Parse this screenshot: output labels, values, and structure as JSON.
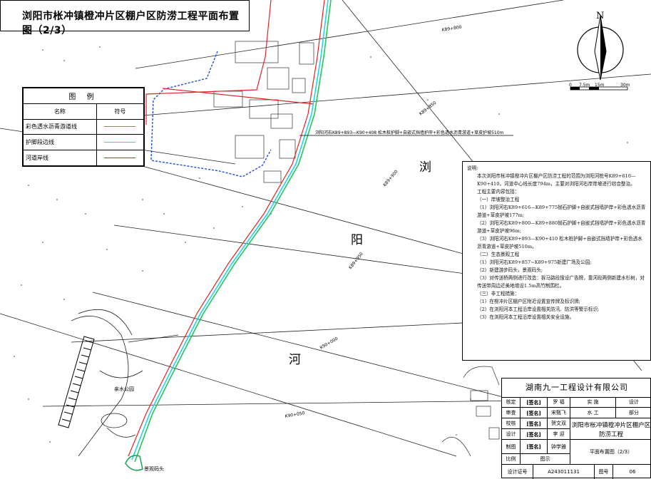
{
  "title": "浏阳市枨冲镇橙冲片区棚户区防涝工程平面布置图（2/3）",
  "legend": {
    "heading": "图 例",
    "col_name": "名称",
    "col_symbol": "符号",
    "items": [
      {
        "name": "彩色透水沥青游道线",
        "color": "#22c55e"
      },
      {
        "name": "护脚段边线",
        "color": "#22d3ee"
      },
      {
        "name": "河道岸线",
        "color": "#dc2626"
      }
    ]
  },
  "north": {
    "letter": "N",
    "scale_ticks": [
      "0",
      "7.5m",
      "15m",
      "30m"
    ]
  },
  "river_chars": [
    "浏",
    "阳",
    "河"
  ],
  "annotations": {
    "callout": "浏阳河右K89+893—K90+408 松木桩护脚+自嵌式挡墙护岸+彩色透水沥青游道+草皮护坡510m",
    "park": "亲水公园",
    "pier": "景观码头"
  },
  "chainage": [
    "K89+800",
    "K89+850",
    "K89+900",
    "K89+950",
    "K90+000",
    "K90+050"
  ],
  "notes": {
    "heading": "说明:",
    "lines": [
      "本次浏阳市枨冲镇橙冲片区棚户区防涝工程的范围为浏阳河桩号K89+616—K90+410，河道中心线长度794m，主要对浏阳河右岸岸坡进行综合整治。",
      "工程主要内容包括：",
      "（一）岸坡整治工程",
      "（1）浏阳河右K89+616—K89+775抛石护脚+自嵌式挡墙护岸+彩色透水沥青游道+草皮护坡177m;",
      "（2）浏阳河右K89+800—K89+880抛石护脚+自嵌式挡墙护岸+彩色透水沥青游道+草皮护坡96m;",
      "（3）浏阳河右K89+893—K90+410 松木桩护脚+自嵌式挡墙护岸+彩色透水沥青游道+草皮护坡510m。",
      "（二）生态景观工程",
      "（1）浏阳河右K89+857~K89+975新建广场及公园;",
      "（2）新建游步码头，景观码头;",
      "（3）对传送桥两侧进行改造：拆马路段搜设广告牌，靠河段两侧新建水杉树，对传送带周边近美地增设1.5m高竹制围栏。",
      "（三）非工程措施：",
      "（1）在橙冲片区棚户区附近设置宣传牌及标识牌;",
      "（2）在浏阳河本工程沿岸设置相关防汛、防洪等警示标识;",
      "（3）在浏阳河本工程沿岸设置相关安全设施。"
    ]
  },
  "title_block": {
    "company": "湖南九一工程设计有限公司",
    "rows": [
      {
        "label": "核定",
        "sig": "[签名]",
        "name": "罗  福",
        "right1": "实  施",
        "right2": "设计"
      },
      {
        "label": "审查",
        "sig": "[签名]",
        "name": "宋甄飞",
        "right1": "水  工",
        "right2": "部分"
      },
      {
        "label": "校核",
        "sig": "[签名]",
        "name": "贺文双"
      },
      {
        "label": "设计",
        "sig": "[签名]",
        "name": "李  迎"
      },
      {
        "label": "制图",
        "sig": "[签名]",
        "name": "钟学雅"
      }
    ],
    "project_name": "浏阳市枨冲镇橙冲片区棚户区防涝工程",
    "drawing_name": "平面布置图（2/3）",
    "scale_label": "比例",
    "scale_value": "图示",
    "cert_label": "设计证号",
    "cert_value": "A243011131",
    "drawing_no_label": "图号",
    "drawing_no_value": "06"
  }
}
